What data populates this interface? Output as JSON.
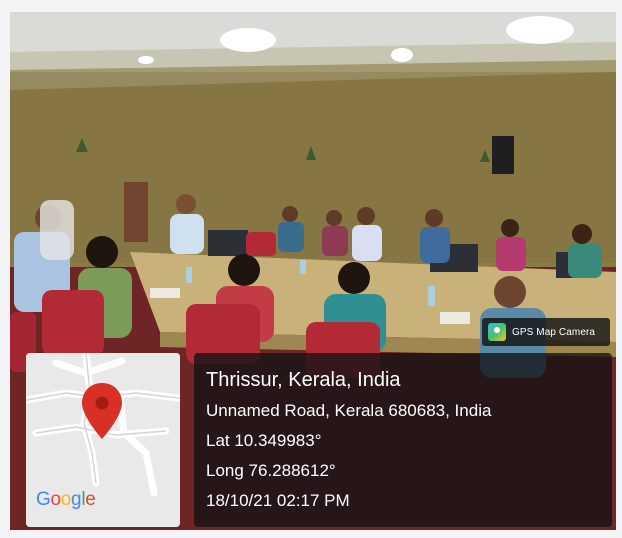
{
  "photo": {
    "scene": "",
    "watermark": {
      "app_label": "GPS Map Camera",
      "location_title": "Thrissur, Kerala, India",
      "address": "Unnamed Road, Kerala 680683, India",
      "latitude": "Lat 10.349983°",
      "longitude": "Long 76.288612°",
      "timestamp": "18/10/21 02:17 PM"
    },
    "map": {
      "logo_text": "Google",
      "pin_color": "#d93025"
    },
    "colors": {
      "wall": "#8a7a45",
      "ceiling": "#d8dbd6",
      "table": "#c9b27a",
      "chair": "#b32a37",
      "floor": "#6e2525"
    }
  }
}
